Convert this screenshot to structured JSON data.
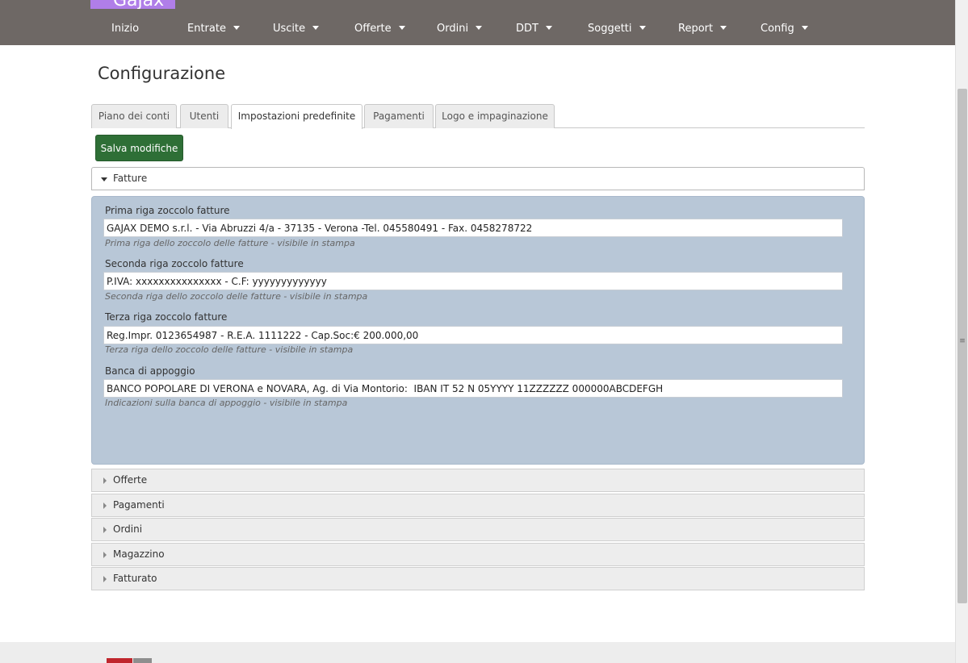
{
  "app": {
    "logo_text": "Gajax"
  },
  "nav": {
    "items": [
      {
        "label": "Inizio",
        "has_menu": false
      },
      {
        "label": "Entrate",
        "has_menu": true
      },
      {
        "label": "Uscite",
        "has_menu": true
      },
      {
        "label": "Offerte",
        "has_menu": true
      },
      {
        "label": "Ordini",
        "has_menu": true
      },
      {
        "label": "DDT",
        "has_menu": true
      },
      {
        "label": "Soggetti",
        "has_menu": true
      },
      {
        "label": "Report",
        "has_menu": true
      },
      {
        "label": "Config",
        "has_menu": true
      }
    ]
  },
  "page": {
    "title": "Configurazione"
  },
  "tabs": [
    {
      "label": "Piano dei conti",
      "active": false
    },
    {
      "label": "Utenti",
      "active": false
    },
    {
      "label": "Impostazioni predefinite",
      "active": true
    },
    {
      "label": "Pagamenti",
      "active": false
    },
    {
      "label": "Logo e impaginazione",
      "active": false
    }
  ],
  "toolbar": {
    "save_label": "Salva modifiche"
  },
  "accordion": {
    "open_section": "Fatture",
    "fields": [
      {
        "label": "Prima riga zoccolo fatture",
        "value": "GAJAX DEMO s.r.l. - Via Abruzzi 4/a - 37135 - Verona -Tel. 045580491 - Fax. 0458278722",
        "help": "Prima riga dello zoccolo delle fatture - visibile in stampa"
      },
      {
        "label": "Seconda riga zoccolo fatture",
        "value": "P.IVA: xxxxxxxxxxxxxxx - C.F: yyyyyyyyyyyyy",
        "help": "Seconda riga dello zoccolo delle fatture - visibile in stampa"
      },
      {
        "label": "Terza riga zoccolo fatture",
        "value": "Reg.Impr. 0123654987 - R.E.A. 1111222 - Cap.Soc:€ 200.000,00",
        "help": "Terza riga dello zoccolo delle fatture - visibile in stampa"
      },
      {
        "label": "Banca di appoggio",
        "value": "BANCO POPOLARE DI VERONA e NOVARA, Ag. di Via Montorio:  IBAN IT 52 N 05YYYY 11ZZZZZZ 000000ABCDEFGH",
        "help": "Indicazioni sulla banca di appoggio - visibile in stampa"
      }
    ],
    "collapsed_sections": [
      "Offerte",
      "Pagamenti",
      "Ordini",
      "Magazzino",
      "Fatturato"
    ]
  },
  "colors": {
    "topbar": "#6e6865",
    "logo": "#b07ee8",
    "save_button": "#2e6f36",
    "panel": "#b8c7d7"
  }
}
